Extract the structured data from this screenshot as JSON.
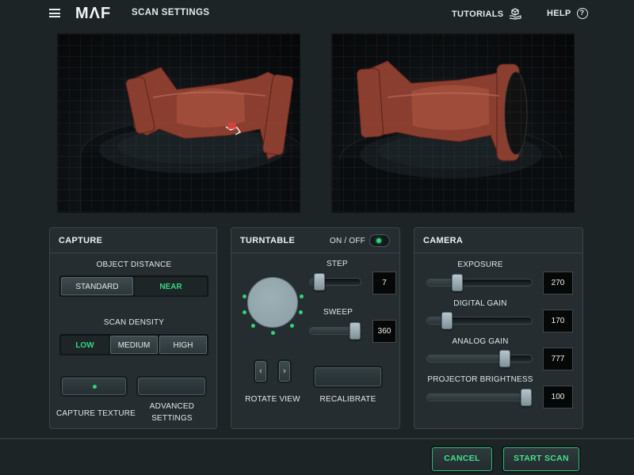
{
  "app": {
    "logo": "MΛF",
    "page_title": "SCAN SETTINGS"
  },
  "topbar": {
    "tutorials_label": "TUTORIALS",
    "help_label": "HELP",
    "help_icon_glyph": "?"
  },
  "capture": {
    "title": "CAPTURE",
    "object_distance_label": "OBJECT DISTANCE",
    "object_distance_options": [
      "STANDARD",
      "NEAR"
    ],
    "object_distance_selected": "NEAR",
    "scan_density_label": "SCAN DENSITY",
    "scan_density_options": [
      "LOW",
      "MEDIUM",
      "HIGH"
    ],
    "scan_density_selected": "LOW",
    "capture_texture_label": "CAPTURE TEXTURE",
    "advanced_settings_label_1": "ADVANCED",
    "advanced_settings_label_2": "SETTINGS"
  },
  "turntable": {
    "title": "TURNTABLE",
    "on_off_label": "ON / OFF",
    "enabled": true,
    "step_label": "STEP",
    "step_value": "7",
    "step_fraction": 0.1,
    "sweep_label": "SWEEP",
    "sweep_value": "360",
    "sweep_fraction": 1.0,
    "rotate_view_label": "ROTATE VIEW",
    "recalibrate_label": "RECALIBRATE",
    "prev_glyph": "‹",
    "next_glyph": "›"
  },
  "camera": {
    "title": "CAMERA",
    "exposure_label": "EXPOSURE",
    "exposure_value": "270",
    "exposure_fraction": 0.26,
    "digital_gain_label": "DIGITAL GAIN",
    "digital_gain_value": "170",
    "digital_gain_fraction": 0.15,
    "analog_gain_label": "ANALOG GAIN",
    "analog_gain_value": "777",
    "analog_gain_fraction": 0.77,
    "projector_brightness_label": "PROJECTOR BRIGHTNESS",
    "projector_brightness_value": "100",
    "projector_brightness_fraction": 1.0
  },
  "actions": {
    "cancel_label": "CANCEL",
    "start_label": "START SCAN"
  },
  "colors": {
    "accent_green": "#37d47e",
    "background": "#1d2426",
    "panel": "#252d30"
  }
}
